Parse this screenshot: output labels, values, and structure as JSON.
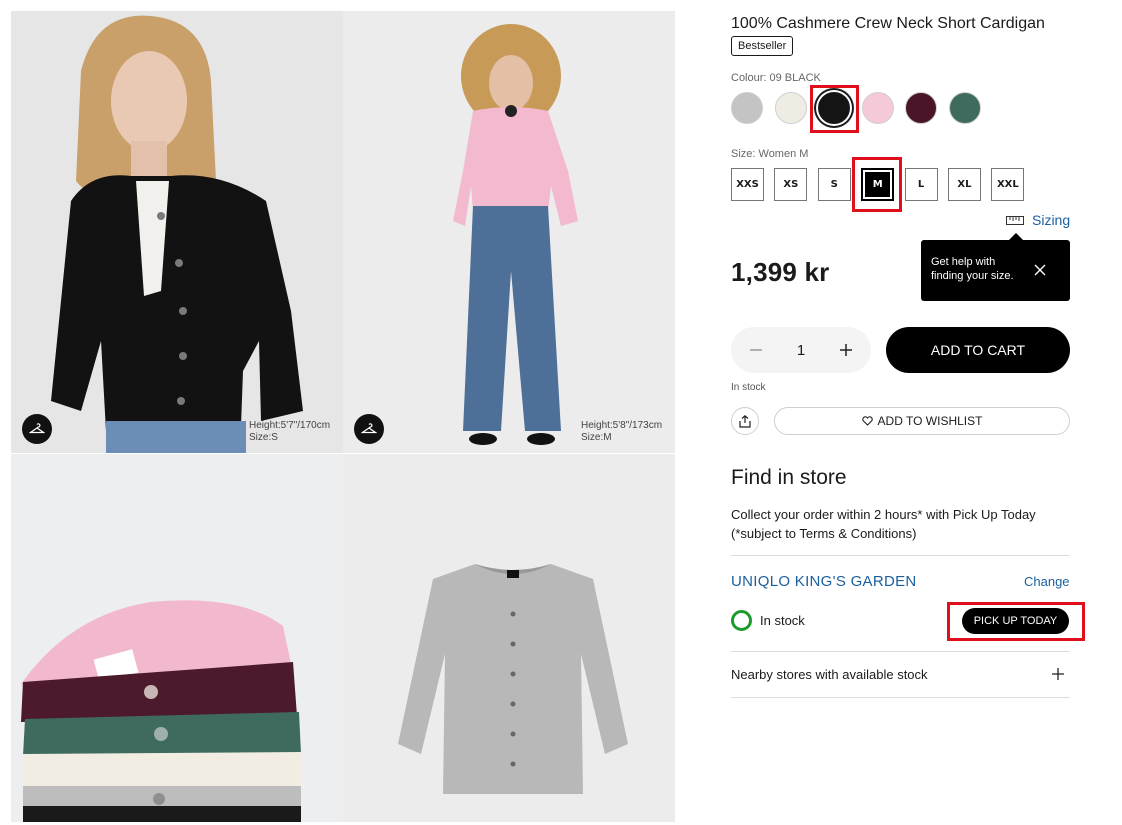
{
  "gallery": {
    "images": [
      {
        "alt": "Model in black cardigan",
        "model_height": "Height:5'7\"/170cm",
        "model_size": "Size:S"
      },
      {
        "alt": "Model in pink cardigan",
        "model_height": "Height:5'8\"/173cm",
        "model_size": "Size:M"
      },
      {
        "alt": "Stack of folded cardigans in various colours"
      },
      {
        "alt": "Grey cardigan flat lay"
      }
    ]
  },
  "product": {
    "title": "100% Cashmere Crew Neck Short Cardigan",
    "badge": "Bestseller",
    "colour_label": "Colour: 09 BLACK",
    "colours": [
      {
        "name": "grey",
        "hex": "#c4c4c4"
      },
      {
        "name": "off white",
        "hex": "#efece4"
      },
      {
        "name": "black",
        "hex": "#141414",
        "selected": true
      },
      {
        "name": "pink",
        "hex": "#f5c9d8"
      },
      {
        "name": "wine",
        "hex": "#4a1529"
      },
      {
        "name": "green",
        "hex": "#3f6b5f"
      }
    ],
    "size_label": "Size: Women M",
    "sizes": [
      "XXS",
      "XS",
      "S",
      "M",
      "L",
      "XL",
      "XXL"
    ],
    "selected_size": "M",
    "sizing_link": "Sizing",
    "tooltip": "Get help with finding your size.",
    "price": "1,399 kr",
    "quantity": "1",
    "add_to_cart": "ADD TO CART",
    "stock_status": "In stock",
    "wishlist": "ADD TO WISHLIST"
  },
  "store": {
    "title": "Find in store",
    "description": "Collect your order within 2 hours* with Pick Up Today (*subject to Terms & Conditions)",
    "store_name": "UNIQLO KING'S GARDEN",
    "change": "Change",
    "stock": "In stock",
    "pickup": "PICK UP TODAY",
    "nearby": "Nearby stores with available stock"
  },
  "colors": {
    "accent_link": "#1a5f9e",
    "in_stock": "#1c9a2c",
    "highlight": "#e0101b"
  }
}
